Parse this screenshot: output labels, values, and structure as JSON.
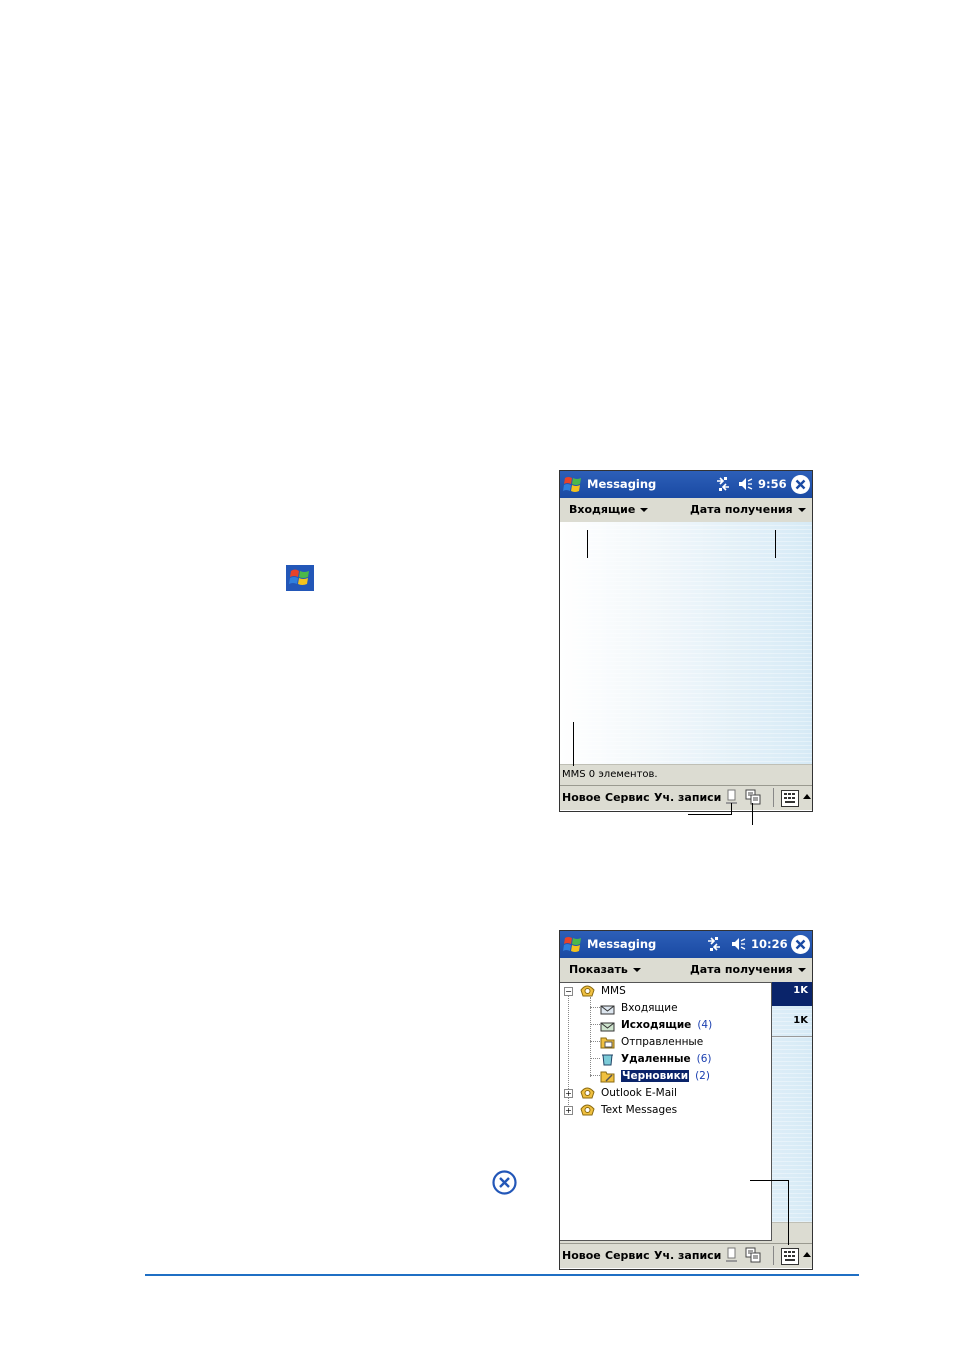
{
  "screen1": {
    "app_title": "Messaging",
    "time": "9:56",
    "folder_filter": "Входящие",
    "sort_filter": "Дата получения",
    "status_text": "MMS  0 элементов.",
    "menu": [
      "Новое",
      "Сервис",
      "Уч. записи"
    ]
  },
  "screen2": {
    "app_title": "Messaging",
    "time": "10:26",
    "show_filter": "Показать",
    "sort_filter": "Дата получения",
    "sizes": [
      "1K",
      "1K"
    ],
    "tree": {
      "root": "MMS",
      "inbox": "Входящие",
      "outbox": "Исходящие",
      "outbox_count": "(4)",
      "sent": "Отправленные",
      "deleted": "Удаленные",
      "deleted_count": "(6)",
      "drafts": "Черновики",
      "drafts_count": "(2)",
      "outlook": "Outlook E-Mail",
      "text": "Text Messages"
    },
    "menu": [
      "Новое",
      "Сервис",
      "Уч. записи"
    ]
  },
  "icons": [
    "windows-start-icon",
    "connectivity-icon",
    "speaker-icon",
    "close-icon",
    "sync-icon",
    "activesync-icon",
    "keyboard-icon"
  ],
  "colors": {
    "titlebar": "#1a4aa3",
    "bar": "#dcdcd2",
    "selection": "#0a246a",
    "rule": "#1f6fc4"
  }
}
